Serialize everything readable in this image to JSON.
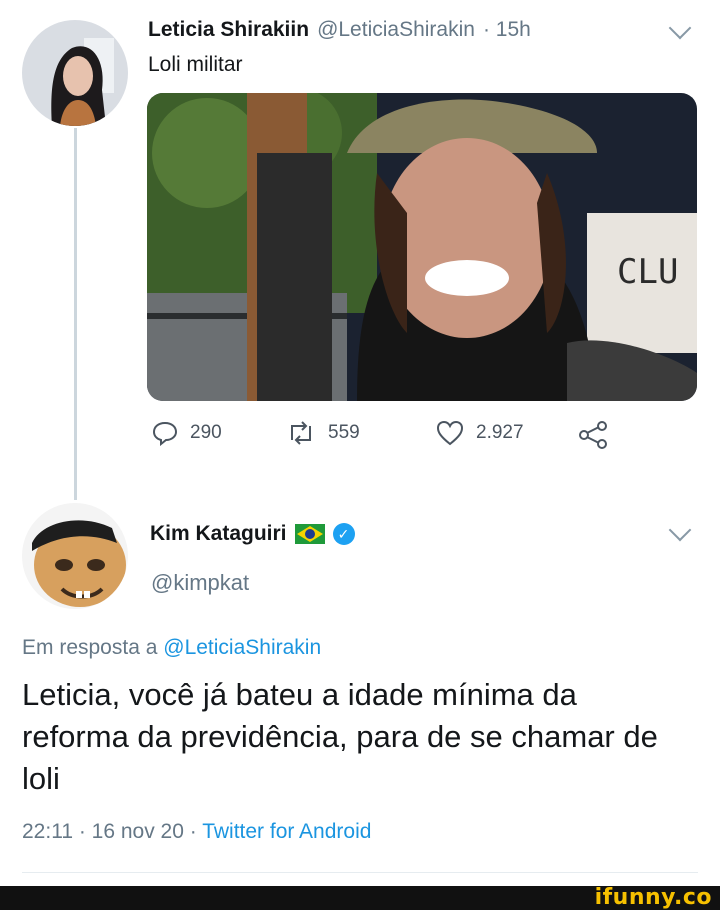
{
  "tweet1": {
    "display_name": "Leticia Shirakiin",
    "handle": "@LeticiaShirakin",
    "time": "· 15h",
    "text": "Loli militar",
    "stats": {
      "replies": "290",
      "retweets": "559",
      "likes": "2.927"
    }
  },
  "tweet2": {
    "display_name": "Kim Kataguiri",
    "handle": "@kimpkat",
    "reply_prefix": "Em resposta a",
    "reply_to": "@LeticiaShirakin",
    "text": "Leticia, você já bateu a idade mínima da reforma da previdência, para de se chamar de loli",
    "timestamp": "22:11 · 16 nov 20 · ",
    "source": "Twitter for Android"
  },
  "watermark": "ifunny.co",
  "icons": {
    "reply": "reply-icon",
    "retweet": "retweet-icon",
    "like": "heart-icon",
    "share": "share-icon",
    "menu": "chevron-down-icon",
    "verified": "verified-badge-icon",
    "flag": "brazil-flag-icon"
  },
  "colors": {
    "link": "#1b95e0",
    "verified": "#1da1f2",
    "muted": "#657786"
  }
}
